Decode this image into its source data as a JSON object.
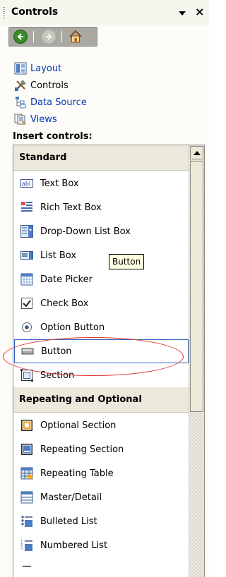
{
  "pane": {
    "title": "Controls",
    "menu_icon": "dropdown-triangle-icon",
    "close_glyph": "×"
  },
  "nav": {
    "back_icon": "back-arrow-icon",
    "forward_icon": "forward-arrow-icon",
    "home_icon": "home-icon"
  },
  "task_links": [
    {
      "label": "Layout",
      "icon": "layout-icon",
      "active": false
    },
    {
      "label": "Controls",
      "icon": "controls-icon",
      "active": true
    },
    {
      "label": "Data Source",
      "icon": "data-source-icon",
      "active": false
    },
    {
      "label": "Views",
      "icon": "views-icon",
      "active": false
    }
  ],
  "insert_label": "Insert controls:",
  "sections": [
    {
      "title": "Standard",
      "items": [
        {
          "label": "Text Box",
          "icon": "text-box-icon"
        },
        {
          "label": "Rich Text Box",
          "icon": "rich-text-box-icon"
        },
        {
          "label": "Drop-Down List Box",
          "icon": "drop-down-list-box-icon"
        },
        {
          "label": "List Box",
          "icon": "list-box-icon"
        },
        {
          "label": "Date Picker",
          "icon": "date-picker-icon"
        },
        {
          "label": "Check Box",
          "icon": "check-box-icon"
        },
        {
          "label": "Option Button",
          "icon": "option-button-icon"
        },
        {
          "label": "Button",
          "icon": "button-icon",
          "selected": true
        },
        {
          "label": "Section",
          "icon": "section-icon"
        }
      ]
    },
    {
      "title": "Repeating and Optional",
      "items": [
        {
          "label": "Optional Section",
          "icon": "optional-section-icon"
        },
        {
          "label": "Repeating Section",
          "icon": "repeating-section-icon"
        },
        {
          "label": "Repeating Table",
          "icon": "repeating-table-icon"
        },
        {
          "label": "Master/Detail",
          "icon": "master-detail-icon"
        },
        {
          "label": "Bulleted List",
          "icon": "bulleted-list-icon"
        },
        {
          "label": "Numbered List",
          "icon": "numbered-list-icon"
        }
      ]
    }
  ],
  "tooltip": "Button",
  "colors": {
    "link": "#0036b9",
    "section_header_bg": "#ebe8dc",
    "selection_border": "#2f5fbd",
    "annotation_ellipse": "#e0302c",
    "tooltip_bg": "#ffffe1"
  }
}
